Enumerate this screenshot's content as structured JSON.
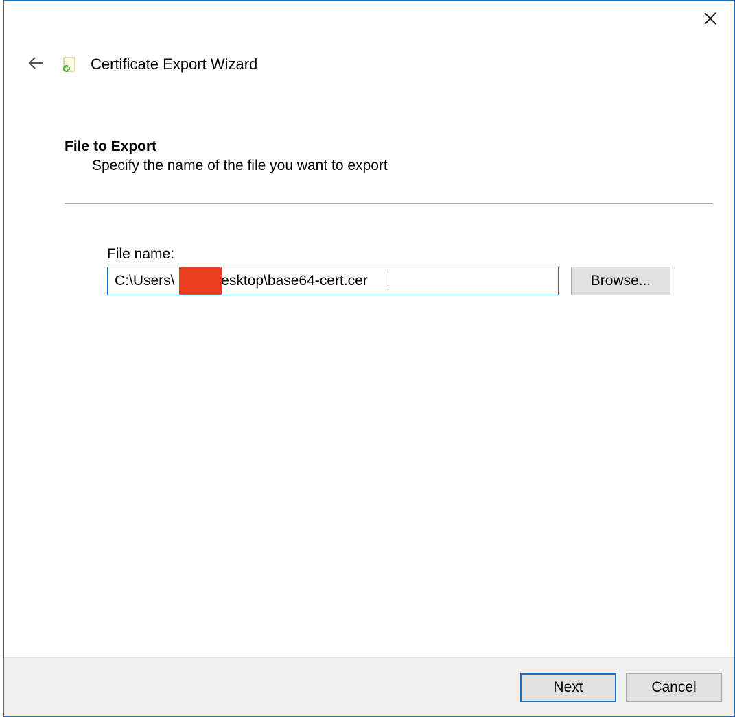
{
  "wizard": {
    "title": "Certificate Export Wizard"
  },
  "page": {
    "heading": "File to Export",
    "subheading": "Specify the name of the file you want to export"
  },
  "form": {
    "file_label": "File name:",
    "file_value": "C:\\Users\\        \\Desktop\\base64-cert.cer",
    "browse_label": "Browse..."
  },
  "footer": {
    "next_label": "Next",
    "cancel_label": "Cancel"
  }
}
